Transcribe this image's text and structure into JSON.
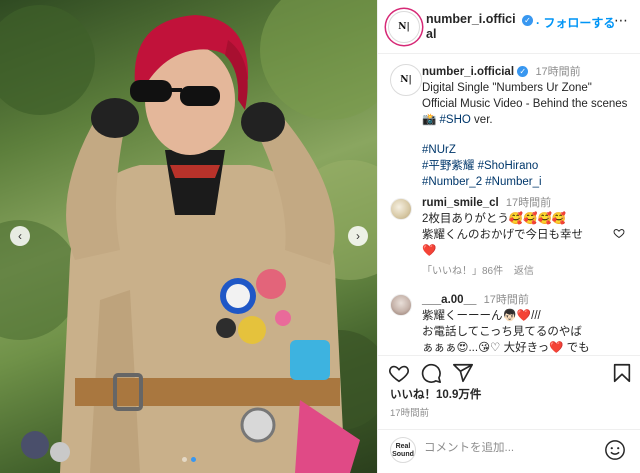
{
  "colors": {
    "accent": "#0095f6",
    "verified": "#3897f0",
    "heart": "#ed4956",
    "hashtag": "#00376b",
    "secondary": "#8e8e8e"
  },
  "header": {
    "avatar_text": "N|",
    "username": "number_i.official",
    "follow_label": "フォローする",
    "more_icon": "⋯"
  },
  "caption": {
    "avatar_text": "N|",
    "username": "number_i.official",
    "time": "17時間前",
    "line1": "Digital Single \"Numbers Ur Zone\"",
    "line2": "Official Music Video - Behind the scenes",
    "line3_emoji": "📸",
    "line3_tag": "#SHO",
    "line3_rest": " ver.",
    "tags": [
      "#NUrZ",
      "#平野紫耀 #ShoHirano",
      "#Number_2 #Number_i"
    ]
  },
  "comments": [
    {
      "username": "rumi_smile_cl",
      "time": "17時間前",
      "lines": [
        "2枚目ありがとう🥰🥰🥰🥰",
        "紫耀くんのおかげで今日も幸せ",
        "❤️"
      ],
      "likes_label": "「いいね！」86件",
      "reply_label": "返信"
    },
    {
      "username": "___a.00__",
      "time": "17時間前",
      "lines": [
        "紫耀くーーーん👦🏻❤️///",
        "お電話してこっち見てるのやば",
        "ぁぁぁ😍...😘♡ 大好きっ❤️ でも"
      ]
    }
  ],
  "actions": {
    "like_count": "いいね！10.9万件",
    "post_time": "17時間前",
    "icons": [
      "heart-icon",
      "comment-icon",
      "share-icon",
      "bookmark-icon"
    ]
  },
  "add_comment": {
    "realsound_label": "Real Sound",
    "placeholder": "コメントを追加...",
    "emoji_icon": "smiley-icon"
  },
  "carousel": {
    "dot_count": 2,
    "active_dot": 1
  }
}
